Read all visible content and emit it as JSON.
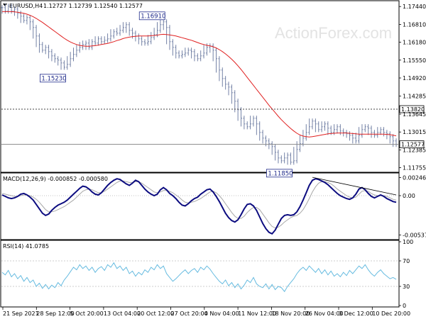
{
  "header": {
    "symbol_text": "EURUSD,H4",
    "ohlc_text": "1.12727 1.12739 1.12540 1.12577",
    "watermark": "ActionForex.com"
  },
  "colors": {
    "background": "#ffffff",
    "bars": "#7482a6",
    "ma_line": "#e02020",
    "macd_line": "#0c0c80",
    "signal_line": "#a8a8a8",
    "rsi_line": "#66bbe0",
    "callout_border": "#1f2a8a",
    "current_price_box": "#ffffff"
  },
  "chart_data": [
    {
      "type": "line",
      "panel": "price",
      "title": "EURUSD,H4",
      "subtitle": "1.12727 1.12739 1.12540 1.12577",
      "y_ticks": [
        "1.17440",
        "1.16810",
        "1.16180",
        "1.15550",
        "1.14920",
        "1.14285",
        "1.13645",
        "1.13015",
        "1.12385",
        "1.11755"
      ],
      "ylim": [
        1.1162,
        1.1762
      ],
      "x_ticks": [
        "21 Sep 2021",
        "28 Sep 12:00",
        "5 Oct 20:00",
        "13 Oct 04:00",
        "20 Oct 12:00",
        "27 Oct 20:00",
        "4 Nov 04:00",
        "11 Nov 12:00",
        "18 Nov 20:00",
        "26 Nov 04:00",
        "3 Dec 12:00",
        "10 Dec 20:00"
      ],
      "series": [
        {
          "values": [
            1.174,
            1.1728,
            1.1745,
            1.1728,
            1.1735,
            1.172,
            1.171,
            1.1695,
            1.1705,
            1.169,
            1.167,
            1.164,
            1.161,
            1.159,
            1.16,
            1.1585,
            1.157,
            1.156,
            1.1555,
            1.1545,
            1.153,
            1.154,
            1.156,
            1.1575,
            1.159,
            1.16,
            1.161,
            1.1615,
            1.16,
            1.162,
            1.1615,
            1.163,
            1.162,
            1.1625,
            1.163,
            1.164,
            1.1655,
            1.165,
            1.166,
            1.167,
            1.168,
            1.166,
            1.165,
            1.164,
            1.163,
            1.162,
            1.1615,
            1.162,
            1.1635,
            1.1645,
            1.166,
            1.168,
            1.169,
            1.167,
            1.162,
            1.16,
            1.158,
            1.157,
            1.1575,
            1.158,
            1.159,
            1.1585,
            1.157,
            1.156,
            1.157,
            1.158,
            1.16,
            1.1605,
            1.159,
            1.156,
            1.152,
            1.149,
            1.147,
            1.146,
            1.144,
            1.141,
            1.138,
            1.135,
            1.133,
            1.132,
            1.133,
            1.135,
            1.133,
            1.13,
            1.128,
            1.127,
            1.126,
            1.125,
            1.123,
            1.121,
            1.12,
            1.121,
            1.122,
            1.1195,
            1.12,
            1.124,
            1.126,
            1.128,
            1.13,
            1.132,
            1.134,
            1.133,
            1.131,
            1.132,
            1.133,
            1.1315,
            1.13,
            1.131,
            1.132,
            1.1305,
            1.13,
            1.1295,
            1.129,
            1.128,
            1.127,
            1.129,
            1.131,
            1.132,
            1.1315,
            1.13,
            1.129,
            1.13,
            1.131,
            1.13,
            1.1295,
            1.1285,
            1.127,
            1.1258
          ],
          "color": "#7482a6"
        },
        {
          "values": [
            1.1726,
            1.1726,
            1.1726,
            1.1726,
            1.1725,
            1.1724,
            1.1722,
            1.172,
            1.1717,
            1.1713,
            1.1708,
            1.1702,
            1.1695,
            1.1688,
            1.168,
            1.1672,
            1.1664,
            1.1656,
            1.1648,
            1.164,
            1.1632,
            1.1625,
            1.1619,
            1.1614,
            1.161,
            1.1607,
            1.1605,
            1.1604,
            1.1604,
            1.1605,
            1.1606,
            1.1608,
            1.161,
            1.1612,
            1.1614,
            1.1617,
            1.162,
            1.1624,
            1.1627,
            1.1631,
            1.1634,
            1.1636,
            1.1638,
            1.1639,
            1.164,
            1.164,
            1.164,
            1.164,
            1.1641,
            1.1642,
            1.1643,
            1.1645,
            1.1646,
            1.1645,
            1.1644,
            1.1642,
            1.164,
            1.1637,
            1.1634,
            1.1631,
            1.1628,
            1.1625,
            1.1621,
            1.1617,
            1.1613,
            1.161,
            1.1607,
            1.1605,
            1.1602,
            1.1598,
            1.1592,
            1.1585,
            1.1577,
            1.1568,
            1.1558,
            1.1547,
            1.1535,
            1.1522,
            1.1508,
            1.1494,
            1.148,
            1.1466,
            1.1452,
            1.1438,
            1.1424,
            1.141,
            1.1396,
            1.1383,
            1.137,
            1.1357,
            1.1345,
            1.1334,
            1.1324,
            1.1314,
            1.1305,
            1.1297,
            1.1291,
            1.1287,
            1.1285,
            1.1284,
            1.1285,
            1.1287,
            1.1289,
            1.1291,
            1.1293,
            1.1295,
            1.1296,
            1.1297,
            1.1298,
            1.1298,
            1.1298,
            1.1298,
            1.1297,
            1.1296,
            1.1295,
            1.1294,
            1.1294,
            1.1294,
            1.1294,
            1.1294,
            1.1294,
            1.1294,
            1.1294,
            1.1294,
            1.1293,
            1.1292,
            1.129,
            1.1288
          ],
          "color": "#e02020"
        }
      ],
      "horizontal_lines": [
        {
          "value": 1.1382,
          "style": "dotted",
          "label": "1.13820"
        },
        {
          "value": 1.1258,
          "style": "solid",
          "label": "1.12577"
        }
      ],
      "annotations": [
        {
          "text": "1.15230",
          "index": 20
        },
        {
          "text": "1.16910",
          "index": 52
        },
        {
          "text": "1.11850",
          "index": 93
        }
      ]
    },
    {
      "type": "line",
      "panel": "macd",
      "title": "MACD(12,26,9) -0.000852 -0.000580",
      "y_ticks": [
        "0.002469",
        "0.00",
        "-0.005375"
      ],
      "ylim": [
        -0.0058,
        0.0029
      ],
      "series": [
        {
          "values": [
            0.0001,
            -0.0001,
            -0.0003,
            -0.0004,
            -0.0003,
            -0.0001,
            0.0002,
            0.0003,
            0.0001,
            -0.0002,
            -0.0006,
            -0.0012,
            -0.0018,
            -0.0024,
            -0.0027,
            -0.0025,
            -0.002,
            -0.0016,
            -0.0013,
            -0.0011,
            -0.0009,
            -0.0006,
            -0.0002,
            0.0002,
            0.0006,
            0.001,
            0.0013,
            0.0012,
            0.0009,
            0.0005,
            0.0002,
            0.0001,
            0.0004,
            0.0009,
            0.0014,
            0.0018,
            0.0021,
            0.0023,
            0.0022,
            0.0019,
            0.0016,
            0.0014,
            0.0017,
            0.0021,
            0.0019,
            0.0014,
            0.0009,
            0.0005,
            0.0002,
            0.0,
            0.0002,
            0.0008,
            0.0011,
            0.0008,
            0.0003,
            0.0,
            -0.0004,
            -0.0009,
            -0.0013,
            -0.0014,
            -0.0011,
            -0.0007,
            -0.0004,
            -0.0002,
            0.0002,
            0.0005,
            0.0008,
            0.0009,
            0.0005,
            -0.0001,
            -0.0008,
            -0.0016,
            -0.0024,
            -0.003,
            -0.0034,
            -0.0036,
            -0.0033,
            -0.0026,
            -0.0018,
            -0.0012,
            -0.0011,
            -0.0014,
            -0.002,
            -0.0029,
            -0.0038,
            -0.0045,
            -0.005,
            -0.0052,
            -0.0047,
            -0.0039,
            -0.0031,
            -0.0027,
            -0.0026,
            -0.0027,
            -0.0026,
            -0.0022,
            -0.0015,
            -0.0006,
            0.0004,
            0.0014,
            0.0021,
            0.0023,
            0.0022,
            0.002,
            0.0018,
            0.0015,
            0.0011,
            0.0007,
            0.0003,
            0.0,
            -0.0002,
            -0.0004,
            -0.0005,
            -0.0003,
            0.0002,
            0.0009,
            0.0011,
            0.0008,
            0.0003,
            -0.0001,
            -0.0003,
            -0.0001,
            0.0001,
            -0.0001,
            -0.0004,
            -0.0006,
            -0.0008,
            -0.0009
          ],
          "color": "#0c0c80"
        },
        {
          "values": [
            0.0003,
            0.0002,
            0.0001,
            0.0,
            -0.0001,
            -0.0001,
            0.0,
            0.0001,
            0.0001,
            0.0,
            -0.0002,
            -0.0005,
            -0.0009,
            -0.0014,
            -0.0019,
            -0.0022,
            -0.0022,
            -0.0021,
            -0.0019,
            -0.0017,
            -0.0015,
            -0.0012,
            -0.0009,
            -0.0006,
            -0.0002,
            0.0002,
            0.0006,
            0.0008,
            0.0009,
            0.0008,
            0.0006,
            0.0004,
            0.0004,
            0.0006,
            0.0009,
            0.0012,
            0.0015,
            0.0018,
            0.002,
            0.002,
            0.0019,
            0.0018,
            0.0018,
            0.0019,
            0.0019,
            0.0017,
            0.0014,
            0.0011,
            0.0008,
            0.0005,
            0.0004,
            0.0005,
            0.0007,
            0.0007,
            0.0006,
            0.0004,
            0.0001,
            -0.0002,
            -0.0006,
            -0.0009,
            -0.001,
            -0.0009,
            -0.0008,
            -0.0006,
            -0.0004,
            -0.0001,
            0.0002,
            0.0005,
            0.0006,
            0.0004,
            0.0,
            -0.0005,
            -0.0011,
            -0.0017,
            -0.0023,
            -0.0028,
            -0.0031,
            -0.0031,
            -0.0028,
            -0.0023,
            -0.0019,
            -0.0016,
            -0.0016,
            -0.0019,
            -0.0025,
            -0.0031,
            -0.0037,
            -0.0042,
            -0.0044,
            -0.0043,
            -0.004,
            -0.0036,
            -0.0033,
            -0.003,
            -0.0028,
            -0.0027,
            -0.0024,
            -0.0019,
            -0.0012,
            -0.0004,
            0.0005,
            0.0012,
            0.0017,
            0.0019,
            0.0019,
            0.0018,
            0.0016,
            0.0013,
            0.0009,
            0.0006,
            0.0003,
            0.0,
            -0.0002,
            -0.0003,
            -0.0002,
            0.0002,
            0.0006,
            0.0007,
            0.0006,
            0.0003,
            0.0001,
            0.0,
            0.0,
            0.0,
            -0.0001,
            -0.0003,
            -0.0005,
            -0.0006
          ],
          "color": "#a8a8a8"
        }
      ],
      "trendline": {
        "from_index": 100,
        "from_value": 0.0025,
        "to_index": 127,
        "to_value": 0.0001
      }
    },
    {
      "type": "line",
      "panel": "rsi",
      "title": "RSI(14) 41.0785",
      "y_ticks": [
        "100",
        "70",
        "30",
        "0"
      ],
      "ylim": [
        0,
        100
      ],
      "levels": [
        70,
        30
      ],
      "series": [
        {
          "values": [
            52,
            48,
            55,
            45,
            50,
            42,
            47,
            38,
            44,
            36,
            40,
            30,
            35,
            27,
            33,
            26,
            32,
            28,
            36,
            31,
            40,
            46,
            53,
            60,
            56,
            64,
            58,
            62,
            55,
            60,
            52,
            58,
            61,
            55,
            64,
            60,
            67,
            58,
            62,
            55,
            60,
            50,
            54,
            46,
            52,
            48,
            56,
            52,
            60,
            56,
            64,
            58,
            62,
            50,
            44,
            38,
            42,
            47,
            52,
            56,
            50,
            55,
            58,
            52,
            60,
            56,
            62,
            57,
            50,
            44,
            38,
            34,
            40,
            31,
            36,
            28,
            34,
            26,
            32,
            40,
            36,
            44,
            34,
            30,
            28,
            34,
            26,
            33,
            25,
            30,
            28,
            22,
            30,
            36,
            42,
            50,
            56,
            60,
            55,
            62,
            57,
            52,
            58,
            50,
            56,
            48,
            54,
            46,
            50,
            45,
            52,
            47,
            55,
            50,
            56,
            62,
            58,
            64,
            56,
            50,
            46,
            52,
            56,
            50,
            46,
            42,
            44,
            41
          ],
          "color": "#66bbe0"
        }
      ]
    }
  ]
}
